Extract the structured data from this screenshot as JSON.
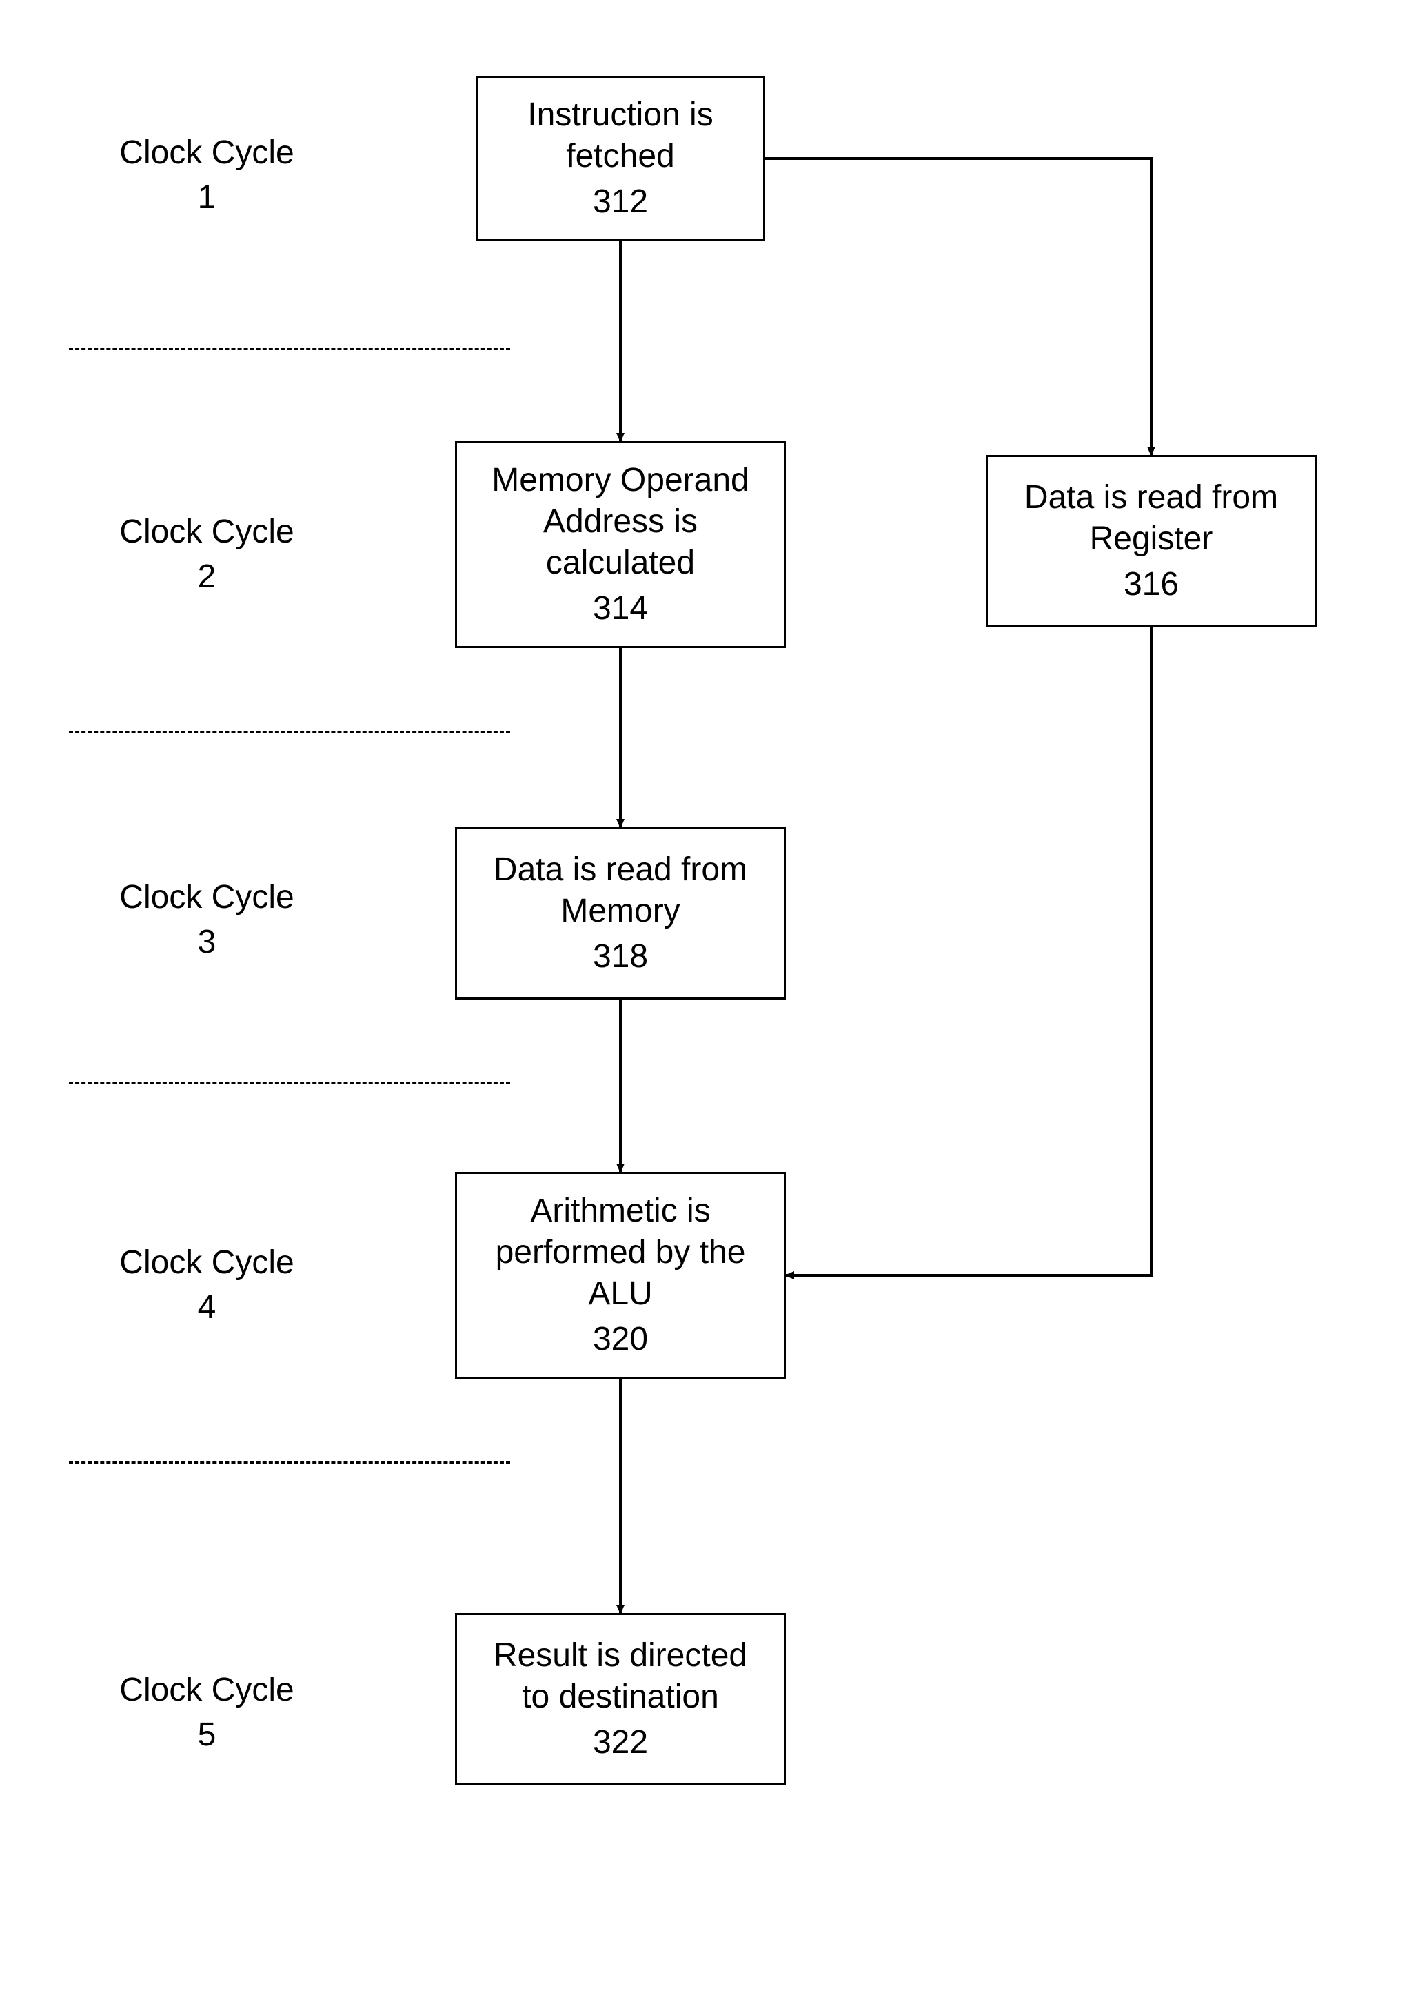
{
  "labels": {
    "cycle1": {
      "line1": "Clock Cycle",
      "line2": "1"
    },
    "cycle2": {
      "line1": "Clock Cycle",
      "line2": "2"
    },
    "cycle3": {
      "line1": "Clock Cycle",
      "line2": "3"
    },
    "cycle4": {
      "line1": "Clock Cycle",
      "line2": "4"
    },
    "cycle5": {
      "line1": "Clock Cycle",
      "line2": "5"
    }
  },
  "boxes": {
    "b312": {
      "line1": "Instruction is",
      "line2": "fetched",
      "ref": "312"
    },
    "b314": {
      "line1": "Memory Operand",
      "line2": "Address is",
      "line3": "calculated",
      "ref": "314"
    },
    "b316": {
      "line1": "Data is read from",
      "line2": "Register",
      "ref": "316"
    },
    "b318": {
      "line1": "Data is read from",
      "line2": "Memory",
      "ref": "318"
    },
    "b320": {
      "line1": "Arithmetic is",
      "line2": "performed by the",
      "line3": "ALU",
      "ref": "320"
    },
    "b322": {
      "line1": "Result is directed",
      "line2": "to destination",
      "ref": "322"
    }
  },
  "chart_data": {
    "type": "flowchart",
    "nodes": [
      {
        "id": "312",
        "text": "Instruction is fetched",
        "cycle": 1
      },
      {
        "id": "314",
        "text": "Memory Operand Address is calculated",
        "cycle": 2
      },
      {
        "id": "316",
        "text": "Data is read from Register",
        "cycle": 2
      },
      {
        "id": "318",
        "text": "Data is read from Memory",
        "cycle": 3
      },
      {
        "id": "320",
        "text": "Arithmetic is performed by the ALU",
        "cycle": 4
      },
      {
        "id": "322",
        "text": "Result is directed to destination",
        "cycle": 5
      }
    ],
    "edges": [
      {
        "from": "312",
        "to": "314"
      },
      {
        "from": "312",
        "to": "316"
      },
      {
        "from": "314",
        "to": "318"
      },
      {
        "from": "318",
        "to": "320"
      },
      {
        "from": "316",
        "to": "320"
      },
      {
        "from": "320",
        "to": "322"
      }
    ],
    "cycle_labels": [
      "Clock Cycle 1",
      "Clock Cycle 2",
      "Clock Cycle 3",
      "Clock Cycle 4",
      "Clock Cycle 5"
    ]
  }
}
